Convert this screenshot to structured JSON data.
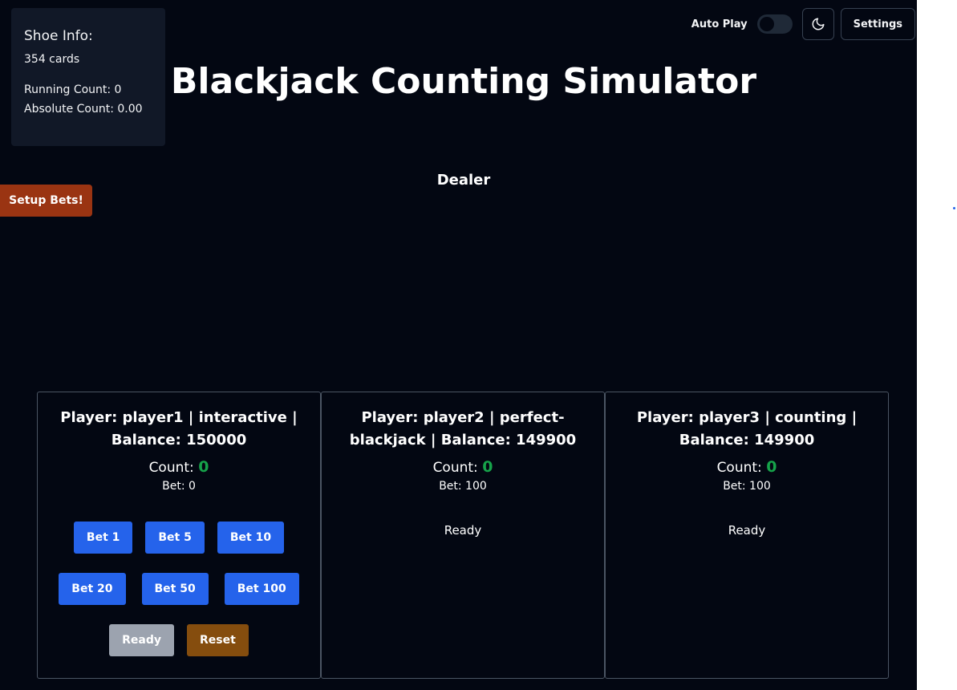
{
  "app": {
    "title": "Blackjack Counting Simulator"
  },
  "shoe": {
    "title": "Shoe Info:",
    "cards": "354 cards",
    "running_count": "Running Count: 0",
    "absolute_count": "Absolute Count: 0.00"
  },
  "topbar": {
    "autoplay_label": "Auto Play",
    "autoplay_on": false,
    "theme_icon": "moon-icon",
    "settings_label": "Settings"
  },
  "setup_bets_label": "Setup Bets!",
  "dealer": {
    "label": "Dealer"
  },
  "players": [
    {
      "title": "Player: player1 | interactive | Balance: 150000",
      "count_label": "Count:",
      "count_value": "0",
      "bet": "Bet: 0",
      "bet_buttons": [
        "Bet 1",
        "Bet 5",
        "Bet 10",
        "Bet 20",
        "Bet 50",
        "Bet 100"
      ],
      "ready_label": "Ready",
      "reset_label": "Reset"
    },
    {
      "title": "Player: player2 | perfect-blackjack | Balance: 149900",
      "count_label": "Count:",
      "count_value": "0",
      "bet": "Bet: 100",
      "status": "Ready"
    },
    {
      "title": "Player: player3 | counting | Balance: 149900",
      "count_label": "Count:",
      "count_value": "0",
      "bet": "Bet: 100",
      "status": "Ready"
    }
  ],
  "colors": {
    "background": "#030712",
    "panel": "#111827",
    "accent_blue": "#2563eb",
    "setup_orange": "#9a3412",
    "reset_brown": "#854d0e",
    "ready_gray": "#9ca3af",
    "count_green": "#16a34a"
  }
}
